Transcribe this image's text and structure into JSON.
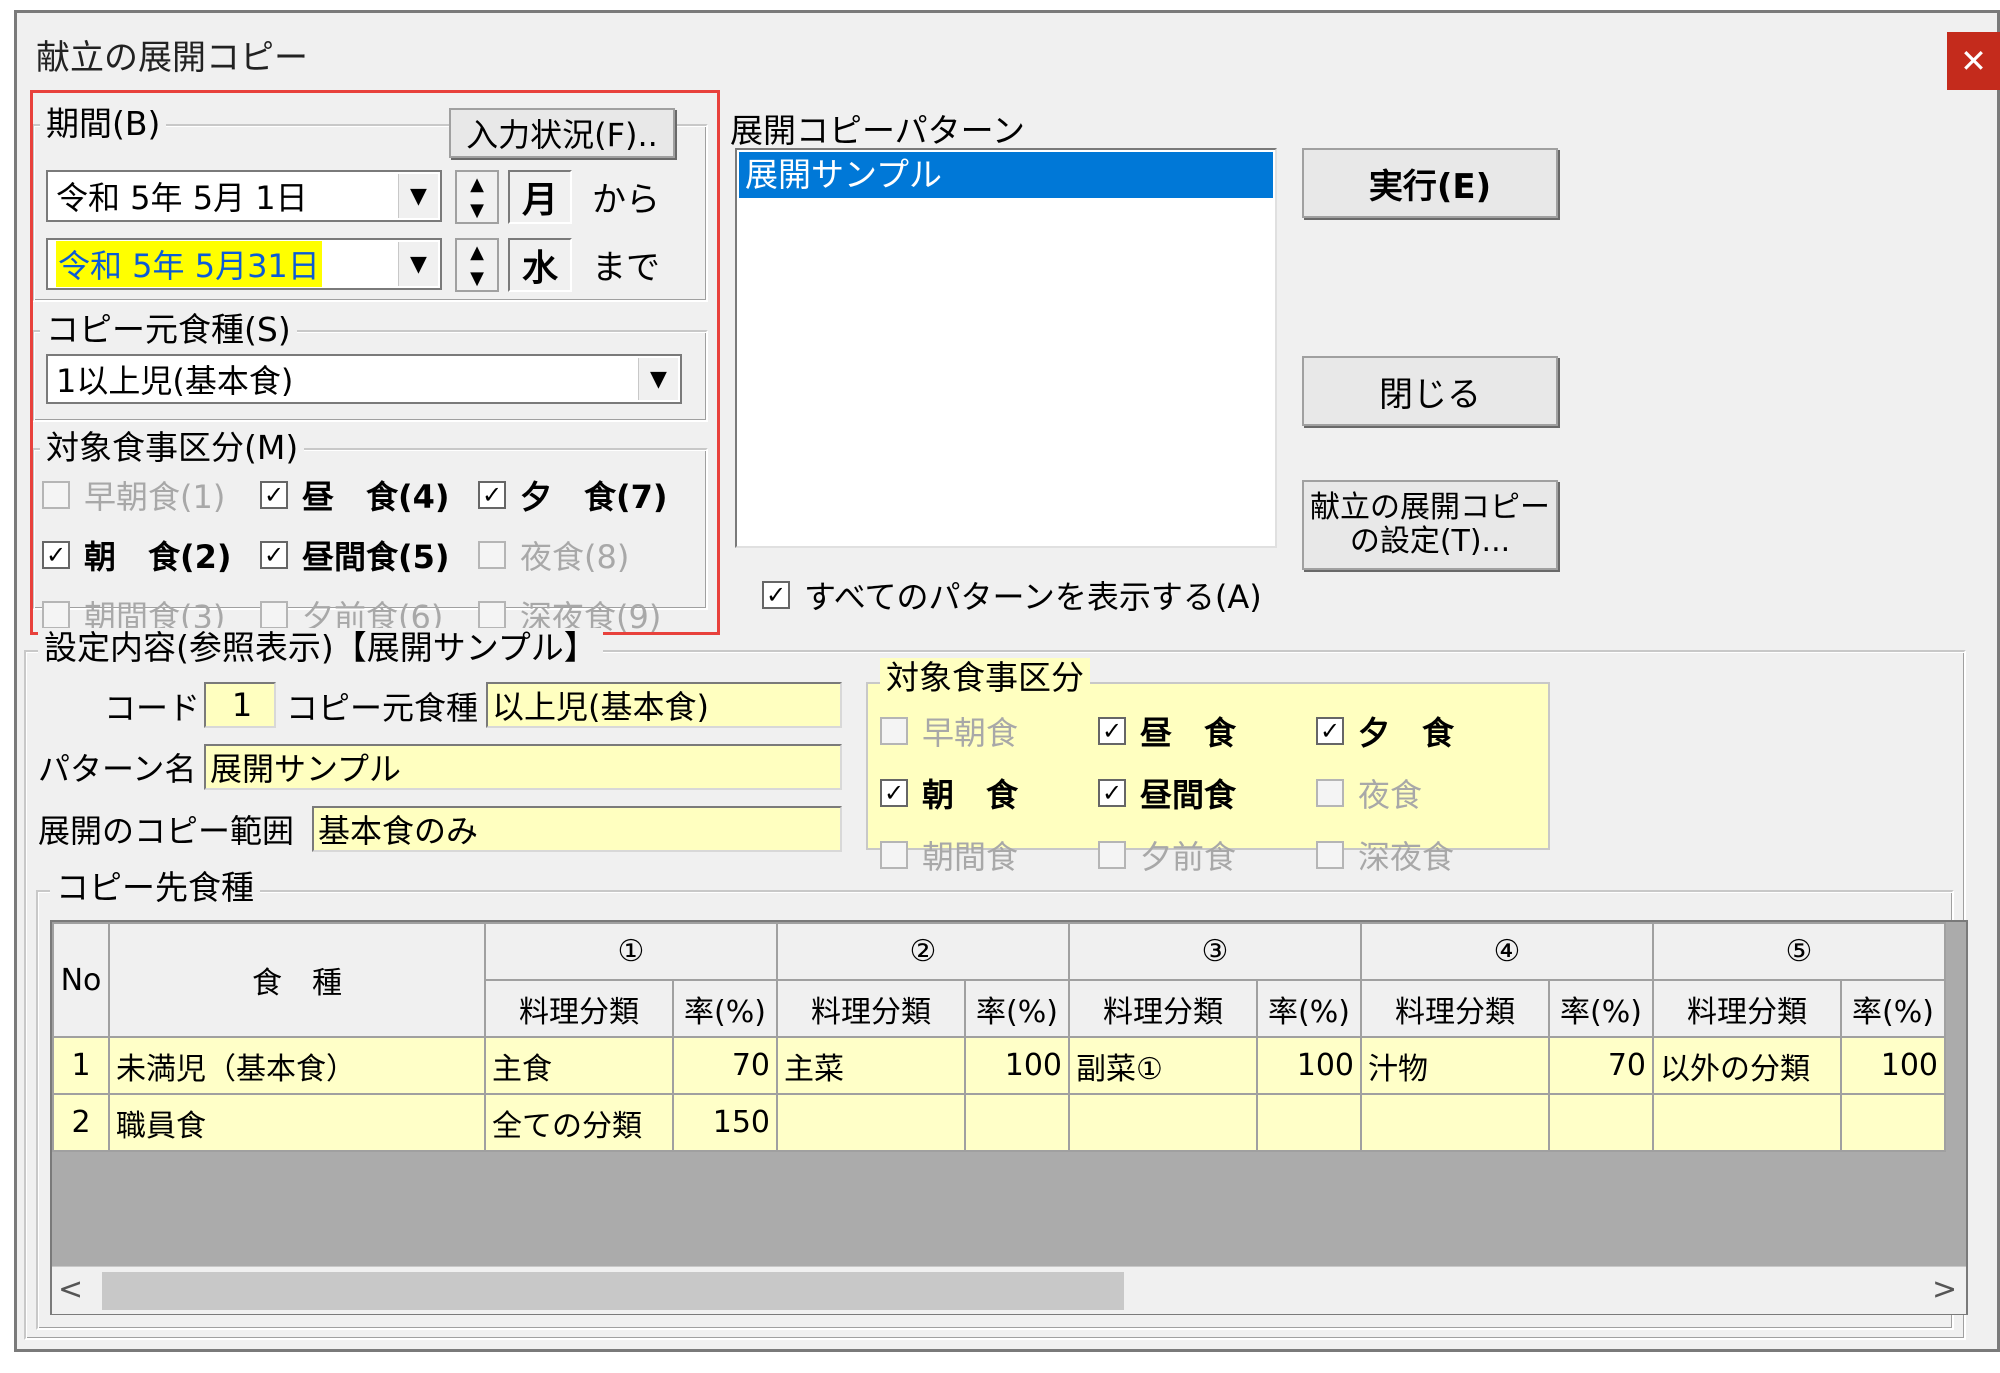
{
  "window": {
    "title": "献立の展開コピー",
    "close_icon": "close-icon"
  },
  "period": {
    "group_label": "期間(B)",
    "input_status_button": "入力状況(F)..",
    "start_date": "令和 5年 5月 1日",
    "start_weekday": "月",
    "start_suffix": "から",
    "end_date": "令和 5年 5月31日",
    "end_weekday": "水",
    "end_suffix": "まで",
    "highlight_color": "#ffff00"
  },
  "source_meal_type": {
    "group_label": "コピー元食種(S)",
    "value": "1以上児(基本食)"
  },
  "meal_divisions": {
    "group_label": "対象食事区分(M)",
    "items": [
      {
        "label": "早朝食(1)",
        "checked": false,
        "enabled": false
      },
      {
        "label": "昼　食(4)",
        "checked": true,
        "enabled": true
      },
      {
        "label": "夕　食(7)",
        "checked": true,
        "enabled": true
      },
      {
        "label": "朝　食(2)",
        "checked": true,
        "enabled": true
      },
      {
        "label": "昼間食(5)",
        "checked": true,
        "enabled": true
      },
      {
        "label": "夜食(8)",
        "checked": false,
        "enabled": false
      },
      {
        "label": "朝間食(3)",
        "checked": false,
        "enabled": false
      },
      {
        "label": "夕前食(6)",
        "checked": false,
        "enabled": false
      },
      {
        "label": "深夜食(9)",
        "checked": false,
        "enabled": false
      }
    ]
  },
  "pattern": {
    "label": "展開コピーパターン",
    "items": [
      "展開サンプル"
    ],
    "selected_color": "#0078d7",
    "show_all_label": "すべてのパターンを表示する(A)",
    "show_all_checked": true
  },
  "buttons": {
    "execute": "実行(E)",
    "close": "閉じる",
    "settings_line1": "献立の展開コピー",
    "settings_line2": "の設定(T)..."
  },
  "settings_view": {
    "group_label": "設定内容(参照表示)【展開サンプル】",
    "code_label": "コード",
    "code_value": "1",
    "source_label": "コピー元食種",
    "source_value": "以上児(基本食)",
    "pattern_name_label": "パターン名",
    "pattern_name_value": "展開サンプル",
    "copy_range_label": "展開のコピー範囲",
    "copy_range_value": "基本食のみ",
    "meal_group_label": "対象食事区分",
    "meal_items": [
      {
        "label": "早朝食",
        "checked": false,
        "enabled": false
      },
      {
        "label": "昼　食",
        "checked": true,
        "enabled": true
      },
      {
        "label": "夕　食",
        "checked": true,
        "enabled": true
      },
      {
        "label": "朝　食",
        "checked": true,
        "enabled": true
      },
      {
        "label": "昼間食",
        "checked": true,
        "enabled": true
      },
      {
        "label": "夜食",
        "checked": false,
        "enabled": false
      },
      {
        "label": "朝間食",
        "checked": false,
        "enabled": false
      },
      {
        "label": "夕前食",
        "checked": false,
        "enabled": false
      },
      {
        "label": "深夜食",
        "checked": false,
        "enabled": false
      }
    ]
  },
  "dest_table": {
    "group_label": "コピー先食種",
    "col_no": "No",
    "col_meal": "食　種",
    "groups": [
      "①",
      "②",
      "③",
      "④",
      "⑤"
    ],
    "sub_category": "料理分類",
    "sub_rate": "率(%)",
    "rows": [
      {
        "no": "1",
        "meal": "未満児（基本食）",
        "cells": [
          [
            "主食",
            "70"
          ],
          [
            "主菜",
            "100"
          ],
          [
            "副菜①",
            "100"
          ],
          [
            "汁物",
            "70"
          ],
          [
            "以外の分類",
            "100"
          ]
        ]
      },
      {
        "no": "2",
        "meal": "職員食",
        "cells": [
          [
            "全ての分類",
            "150"
          ],
          [
            "",
            ""
          ],
          [
            "",
            ""
          ],
          [
            "",
            ""
          ],
          [
            "",
            ""
          ]
        ]
      }
    ],
    "scroll_left_icon": "<",
    "scroll_right_icon": ">"
  },
  "colors": {
    "annotation_red": "#e8413c",
    "field_yellow": "#ffffc0"
  }
}
